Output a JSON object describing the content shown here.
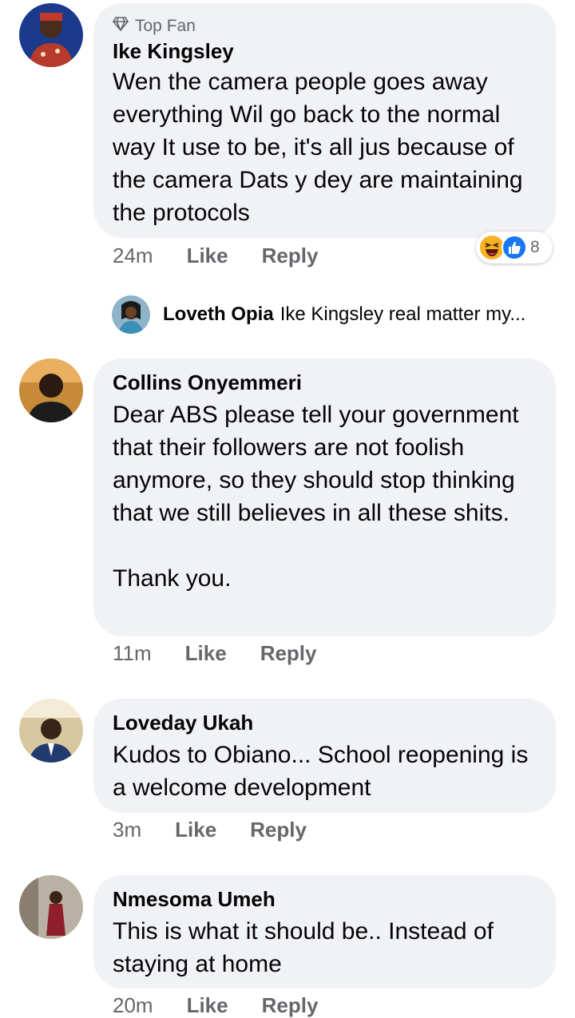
{
  "comments": [
    {
      "badge": "Top Fan",
      "author": "Ike Kingsley",
      "text": "Wen the camera people goes away everything Wil go back to the normal way It use to be, it's all jus because of the camera Dats y dey are maintaining the protocols",
      "time": "24m",
      "like": "Like",
      "reply": "Reply",
      "reaction_count": "8",
      "reaction_icons": [
        "laugh-icon",
        "like-icon"
      ],
      "reply_preview": {
        "author": "Loveth Opia",
        "text": "Ike Kingsley real matter my..."
      }
    },
    {
      "author": "Collins Onyemmeri",
      "text": "Dear ABS please tell your government that their followers are not foolish anymore, so they should stop thinking that we still believes in all these shits.\n\nThank you.",
      "time": "11m",
      "like": "Like",
      "reply": "Reply"
    },
    {
      "author": "Loveday Ukah",
      "text": "Kudos to Obiano... School reopening is a welcome development",
      "time": "3m",
      "like": "Like",
      "reply": "Reply"
    },
    {
      "author": "Nmesoma Umeh",
      "text": "This is what it should be.. Instead of staying at home",
      "time": "20m",
      "like": "Like",
      "reply": "Reply"
    }
  ],
  "colors": {
    "bubble": "#f0f2f5",
    "meta": "#65676b",
    "like_blue": "#1877f2",
    "laugh_yellow": "#f7b125"
  }
}
